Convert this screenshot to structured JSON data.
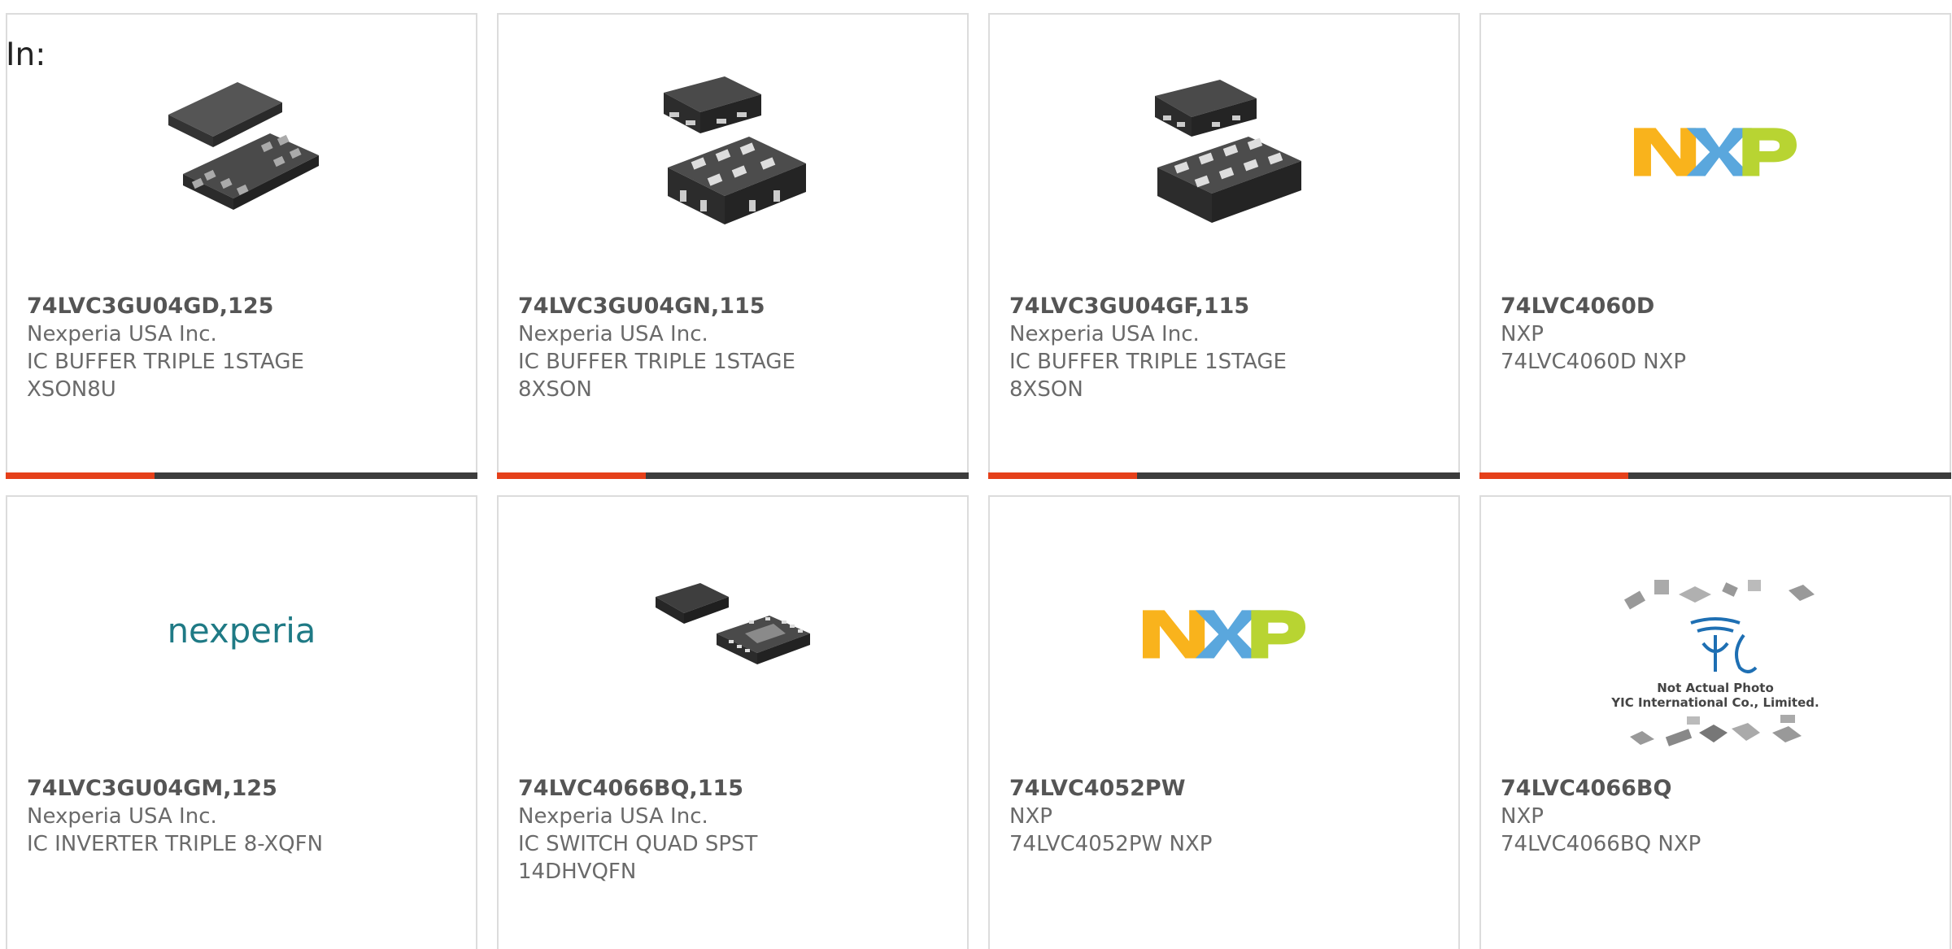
{
  "filter_label": "In:",
  "products": [
    {
      "part": "74LVC3GU04GD,125",
      "maker": "Nexperia USA Inc.",
      "desc": [
        "IC BUFFER TRIPLE 1STAGE",
        "XSON8U"
      ],
      "image": "xson-package-icon"
    },
    {
      "part": "74LVC3GU04GN,115",
      "maker": "Nexperia USA Inc.",
      "desc": [
        "IC BUFFER TRIPLE 1STAGE",
        "8XSON"
      ],
      "image": "xson-package-icon"
    },
    {
      "part": "74LVC3GU04GF,115",
      "maker": "Nexperia USA Inc.",
      "desc": [
        "IC BUFFER TRIPLE 1STAGE",
        "8XSON"
      ],
      "image": "xson-package-icon"
    },
    {
      "part": "74LVC4060D",
      "maker": "NXP",
      "desc": [
        "74LVC4060D NXP",
        ""
      ],
      "image": "nxp-logo"
    },
    {
      "part": "74LVC3GU04GM,125",
      "maker": "Nexperia USA Inc.",
      "desc": [
        "IC INVERTER TRIPLE 8-XQFN",
        ""
      ],
      "image": "nexperia-logo"
    },
    {
      "part": "74LVC4066BQ,115",
      "maker": "Nexperia USA Inc.",
      "desc": [
        "IC SWITCH QUAD SPST",
        "14DHVQFN"
      ],
      "image": "qfn-package-icon"
    },
    {
      "part": "74LVC4052PW",
      "maker": "NXP",
      "desc": [
        "74LVC4052PW NXP",
        ""
      ],
      "image": "nxp-logo"
    },
    {
      "part": "74LVC4066BQ",
      "maker": "NXP",
      "desc": [
        "74LVC4066BQ NXP",
        ""
      ],
      "image": "yic-placeholder"
    }
  ],
  "logos": {
    "nexperia": "nexperia",
    "yic_caption_1": "Not Actual Photo",
    "yic_caption_2": "YIC International Co., Limited."
  },
  "colors": {
    "accent": "#e5401a",
    "bar": "#3c3c3c",
    "nxp_orange": "#f9b31c",
    "nxp_blue": "#5aa7dd",
    "nxp_green": "#b8d432",
    "nexperia_teal": "#1f7a85"
  }
}
